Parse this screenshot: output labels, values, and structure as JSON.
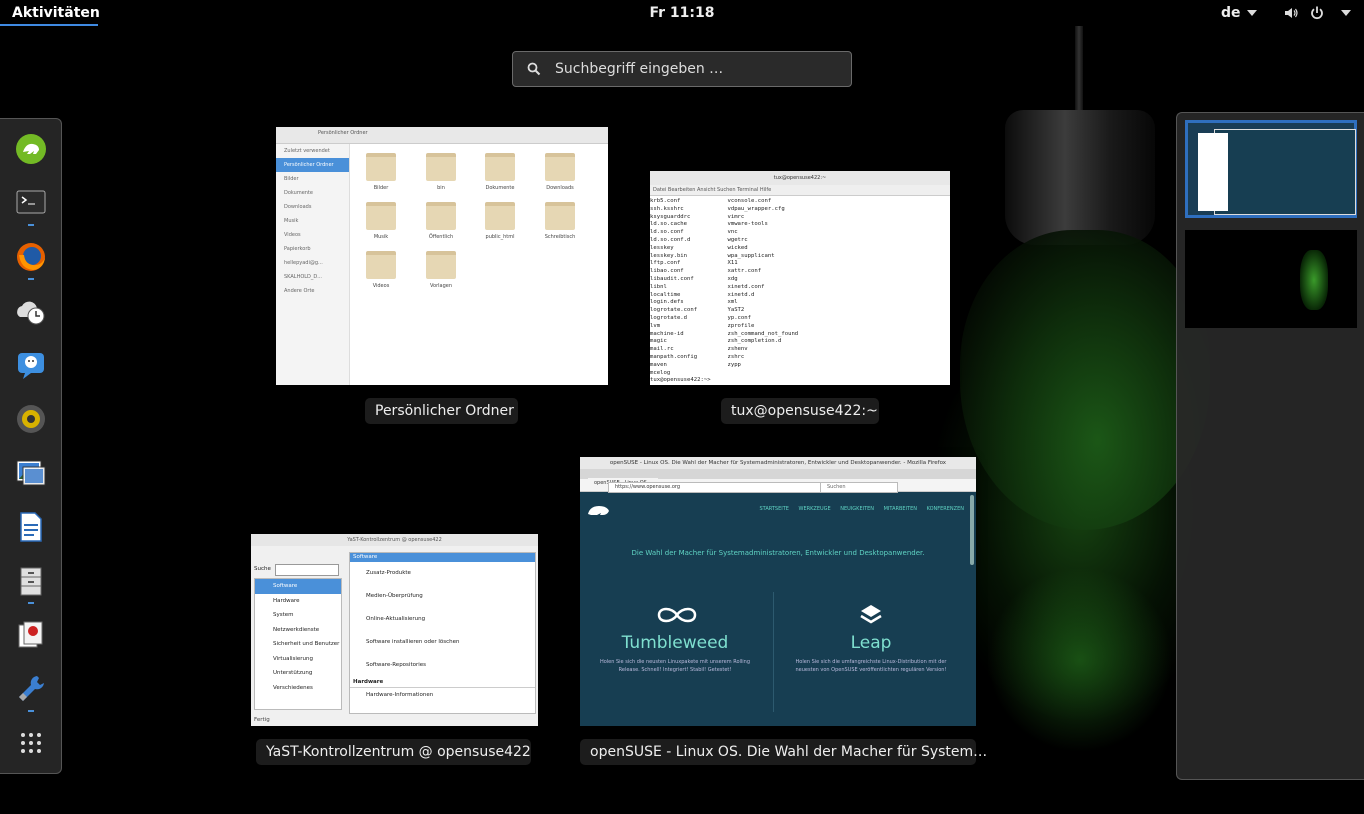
{
  "topbar": {
    "activities": "Aktivitäten",
    "clock": "Fr 11:18",
    "language": "de"
  },
  "search": {
    "placeholder": "Suchbegriff eingeben …"
  },
  "dash": {
    "items": [
      {
        "icon": "yast-chameleon-icon"
      },
      {
        "icon": "terminal-icon"
      },
      {
        "icon": "firefox-icon"
      },
      {
        "icon": "clock-backup-icon"
      },
      {
        "icon": "chat-icon"
      },
      {
        "icon": "speaker-icon"
      },
      {
        "icon": "image-viewer-icon"
      },
      {
        "icon": "writer-document-icon"
      },
      {
        "icon": "file-cabinet-icon"
      },
      {
        "icon": "documents-icon"
      },
      {
        "icon": "wrench-settings-icon"
      },
      {
        "icon": "app-grid-icon"
      }
    ]
  },
  "windows": {
    "files": {
      "title": "Persönlicher Ordner",
      "path": "Persönlicher Ordner",
      "sidebar": [
        "Zuletzt verwendet",
        "Persönlicher Ordner",
        "Bilder",
        "Dokumente",
        "Downloads",
        "Musik",
        "Videos",
        "Papierkorb",
        "hellepyadi@g...",
        "SKALHOLD_D...",
        "Andere Orte"
      ],
      "folders": [
        "Bilder",
        "bin",
        "Dokumente",
        "Downloads",
        "Musik",
        "Öffentlich",
        "public_html",
        "Schreibtisch",
        "Videos",
        "Vorlagen"
      ]
    },
    "terminal": {
      "title": "tux@opensuse422:~",
      "window_title": "tux@opensuse422:~",
      "menu": "Datei   Bearbeiten   Ansicht   Suchen   Terminal   Hilfe",
      "listing": "krb5.conf              vconsole.conf\nssh.ksshrc             vdpau_wrapper.cfg\nksysguarddrc           vimrc\nld.so.cache            vmware-tools\nld.so.conf             vnc\nld.so.conf.d           wgetrc\nlesskey                wicked\nlesskey.bin            wpa_supplicant\nlftp.conf              X11\nlibao.conf             xattr.conf\nlibaudit.conf          xdg\nlibnl                  xinetd.conf\nlocaltime              xinetd.d\nlogin.defs             xml\nlogrotate.conf         YaST2\nlogrotate.d            yp.conf\nlvm                    zprofile\nmachine-id             zsh_command_not_found\nmagic                  zsh_completion.d\nmail.rc                zshenv\nmanpath.config         zshrc\nmaven                  zypp\nmcelog\ntux@opensuse422:~> "
    },
    "yast": {
      "title": "YaST-Kontrollzentrum @ opensuse422",
      "window_title": "YaST-Kontrollzentrum @ opensuse422",
      "search_label": "Suche",
      "categories": [
        "Software",
        "Hardware",
        "System",
        "Netzwerkdienste",
        "Sicherheit und Benutzer",
        "Virtualisierung",
        "Unterstützung",
        "Verschiedenes"
      ],
      "section": "Software",
      "modules": [
        "Zusatz-Produkte",
        "Medien-Überprüfung",
        "Online-Aktualisierung",
        "Software installieren oder löschen",
        "Software-Repositories"
      ],
      "section2": "Hardware",
      "module2": "Hardware-Informationen",
      "status": "Fertig"
    },
    "firefox": {
      "title": "openSUSE - Linux OS. Die Wahl der Macher für System…",
      "window_title": "openSUSE - Linux OS. Die Wahl der Macher für Systemadministratoren, Entwickler und Desktopanwender. - Mozilla Firefox",
      "tab": "openSUSE - Linux OS...",
      "url": "https://www.opensuse.org",
      "search_box": "Suchen",
      "nav": "STARTSEITE WERKZEUGE NEUIGKEITEN MITARBEITEN KONFERENZEN",
      "tagline": "Die Wahl der Macher für Systemadministratoren, Entwickler und Desktopanwender.",
      "tumbleweed": "Tumbleweed",
      "tumbleweed_text": "Holen Sie sich die neusten Linuxpakete mit unserem Rolling Release. Schnell! Integriert! Stabil! Getestet!",
      "leap": "Leap",
      "leap_text": "Holen Sie sich die umfangreichste Linux-Distribution mit der neuesten von OpenSUSE veröffentlichten regulären Version!"
    }
  },
  "colors": {
    "accent": "#4a90d9",
    "firefox_bg": "#173e52",
    "opensuse_green": "#73ba25"
  }
}
